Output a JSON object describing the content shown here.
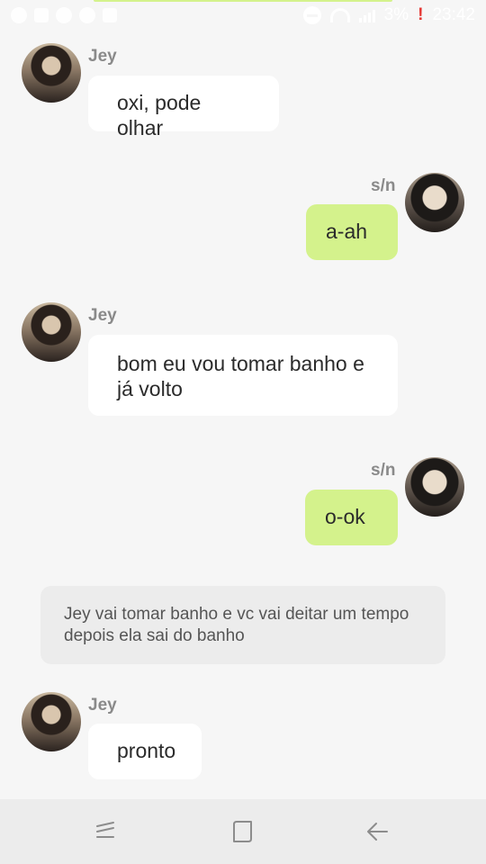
{
  "status_bar": {
    "left_icons": [
      "whatsapp-icon",
      "battery-saver-icon",
      "messenger-icon",
      "chat-icon",
      "gallery-icon"
    ],
    "battery": "3%",
    "battery_warning": "!",
    "time": "23:42"
  },
  "messages": [
    {
      "sender": "Jey",
      "side": "left",
      "text": "oxi, pode olhar"
    },
    {
      "sender": "s/n",
      "side": "right",
      "text": "a-ah"
    },
    {
      "sender": "Jey",
      "side": "left",
      "text": "bom eu vou tomar banho e já volto"
    },
    {
      "sender": "s/n",
      "side": "right",
      "text": "o-ok"
    }
  ],
  "narration": "Jey vai tomar banho e vc vai deitar um tempo depois ela sai do banho",
  "last_message": {
    "sender": "Jey",
    "side": "left",
    "text": "pronto"
  },
  "colors": {
    "background": "#f6f6f6",
    "incoming_bubble": "#ffffff",
    "outgoing_bubble": "#d4f28c",
    "narration_bubble": "#ececec",
    "nav_bar": "#ececec"
  },
  "nav_bar": {
    "buttons": [
      "recent-apps",
      "home",
      "back"
    ]
  }
}
